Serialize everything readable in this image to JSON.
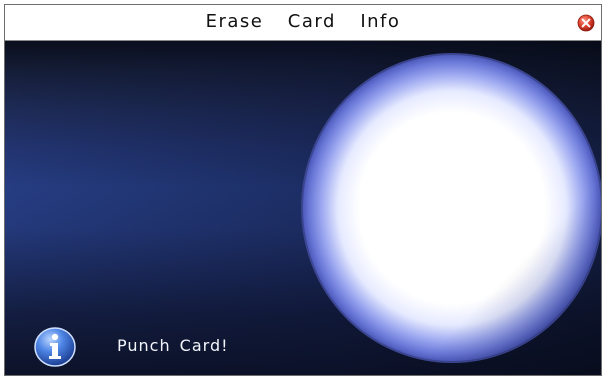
{
  "window": {
    "title": "Erase  Card  Info",
    "close_icon": "close-icon"
  },
  "main": {
    "card_reader_icon": "card-scan-orb",
    "status_icon": "info-icon",
    "status_message": "Punch Card!"
  },
  "colors": {
    "title_bar": "#ffffff",
    "background_dark": "#0a0e1c",
    "background_mid": "#253d82",
    "orb_rim": "#5f6fd8",
    "close_button": "#e0452f",
    "info_icon": "#3f74d8"
  }
}
